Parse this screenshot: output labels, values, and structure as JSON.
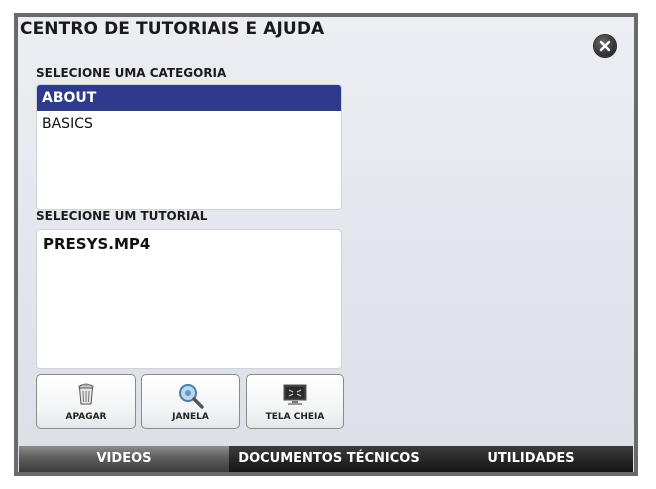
{
  "dialog": {
    "title": "CENTRO DE TUTORIAIS E AJUDA",
    "close_icon": "close-circle-icon"
  },
  "categories": {
    "label": "SELECIONE UMA CATEGORIA",
    "items": [
      {
        "label": "ABOUT",
        "selected": true
      },
      {
        "label": "BASICS",
        "selected": false
      }
    ]
  },
  "tutorials": {
    "label": "SELECIONE UM TUTORIAL",
    "items": [
      {
        "label": "PRESYS.MP4"
      }
    ]
  },
  "toolbar": {
    "delete": {
      "label": "APAGAR",
      "icon": "trash-icon"
    },
    "window": {
      "label": "JANELA",
      "icon": "magnifier-icon"
    },
    "fullscreen": {
      "label": "TELA CHEIA",
      "icon": "fullscreen-monitor-icon"
    }
  },
  "tabs": [
    {
      "label": "VIDEOS",
      "active": true
    },
    {
      "label": "DOCUMENTOS TÉCNICOS",
      "active": false
    },
    {
      "label": "UTILIDADES",
      "active": false
    }
  ],
  "colors": {
    "selection": "#2e3a8c",
    "frame_border": "#6a6a6a",
    "tabbar": "#1a1a1a"
  }
}
